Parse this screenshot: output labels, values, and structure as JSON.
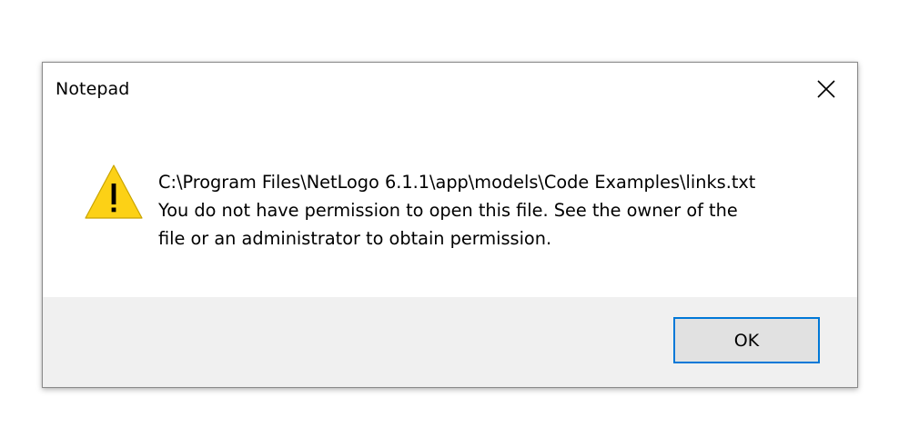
{
  "window": {
    "title": "Notepad",
    "close_icon": "close-icon"
  },
  "message": {
    "icon": "warning-icon",
    "lines": [
      "C:\\Program Files\\NetLogo 6.1.1\\app\\models\\Code Examples\\links.txt",
      "You do not have permission to open this file.  See the owner of the",
      "file or an administrator to obtain permission."
    ]
  },
  "buttons": {
    "ok_label": "OK"
  },
  "colors": {
    "accent": "#0078d7",
    "warning_fill": "#fcd116",
    "footer_bg": "#f0f0f0"
  }
}
